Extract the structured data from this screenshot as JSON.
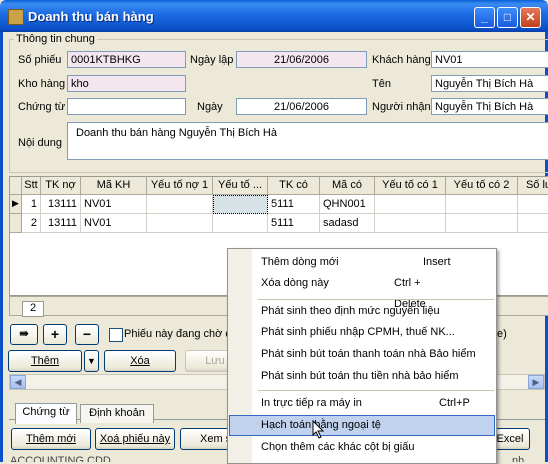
{
  "window": {
    "title": "Doanh thu bán hàng",
    "min": "_",
    "max": "□",
    "close": "✕"
  },
  "info": {
    "group_title": "Thông tin chung",
    "so_phieu_label": "Số phiếu",
    "so_phieu": "0001KTBHKG",
    "ngay_lap_label": "Ngày lập",
    "ngay_lap": "21/06/2006",
    "khach_hang_label": "Khách hàng",
    "khach_hang": "NV01",
    "kho_hang_label": "Kho hàng",
    "kho_hang": "kho",
    "ten_label": "Tên",
    "ten": "Nguyễn Thị Bích Hà",
    "chung_tu_label": "Chứng từ",
    "chung_tu": "",
    "ngay_label": "Ngày",
    "ngay": "21/06/2006",
    "nguoi_nhan_label": "Người nhận",
    "nguoi_nhan": "Nguyễn Thị Bích Hà",
    "noi_dung_label": "Nội dung",
    "noi_dung": "Doanh thu bán hàng Nguyễn Thị Bích Hà"
  },
  "grid": {
    "columns": [
      "Stt",
      "TK nợ",
      "Mã KH",
      "Yếu tố nợ 1",
      "Yếu tố ...",
      "TK có",
      "Mã có",
      "Yếu tố có 1",
      "Yếu tố có 2",
      "Số lu"
    ],
    "rows": [
      {
        "stt": "1",
        "tk_no": "13111",
        "ma_kh": "NV01",
        "yt_no1": "",
        "yt_no2": "",
        "tk_co": "5111",
        "ma_co": "QHN001",
        "yt_co1": "",
        "yt_co2": "",
        "so_lu": ""
      },
      {
        "stt": "2",
        "tk_no": "13111",
        "ma_kh": "NV01",
        "yt_no1": "",
        "yt_no2": "",
        "tk_co": "5111",
        "ma_co": "sadasd",
        "yt_co1": "",
        "yt_co2": "",
        "so_lu": ""
      }
    ],
    "record_count": "2"
  },
  "toolbar": {
    "pending_label": "Phiếu này đang chờ du",
    "add_label": "Thêm",
    "delete_label": "Xóa",
    "save_label": "Lưu",
    "right_text": "e)"
  },
  "tabs": [
    "Chứng từ",
    "Định khoản"
  ],
  "bottom": {
    "new_label": "Thêm mới",
    "delete_label": "Xoá phiếu này",
    "view_label": "Xem s",
    "excel_label": "Excel",
    "status_text": "ACCOUNTING CDD",
    "status_right": "nh"
  },
  "menu": {
    "items": [
      {
        "label": "Thêm dòng mới",
        "shortcut": "Insert"
      },
      {
        "label": "Xóa dòng này",
        "shortcut": "Ctrl + Delete"
      },
      {
        "label": "Phát sinh theo định mức nguyên liệu",
        "shortcut": ""
      },
      {
        "label": "Phát sinh phiếu nhập CPMH, thuế NK...",
        "shortcut": ""
      },
      {
        "label": "Phát sinh bút toán thanh toán nhà Bảo hiểm",
        "shortcut": ""
      },
      {
        "label": "Phát sinh bút toán thu tiền nhà bảo hiểm",
        "shortcut": ""
      },
      {
        "label": "In trực tiếp ra máy in",
        "shortcut": "Ctrl+P"
      },
      {
        "label": "Hạch toán bằng ngoại tệ",
        "shortcut": ""
      },
      {
        "label": "Chọn thêm các khác cột bị giấu",
        "shortcut": ""
      }
    ]
  },
  "colors": {
    "titlebar": "#0a50c8",
    "menu_highlight": "#c1d2ee",
    "pink_field": "#f4e6ee"
  }
}
